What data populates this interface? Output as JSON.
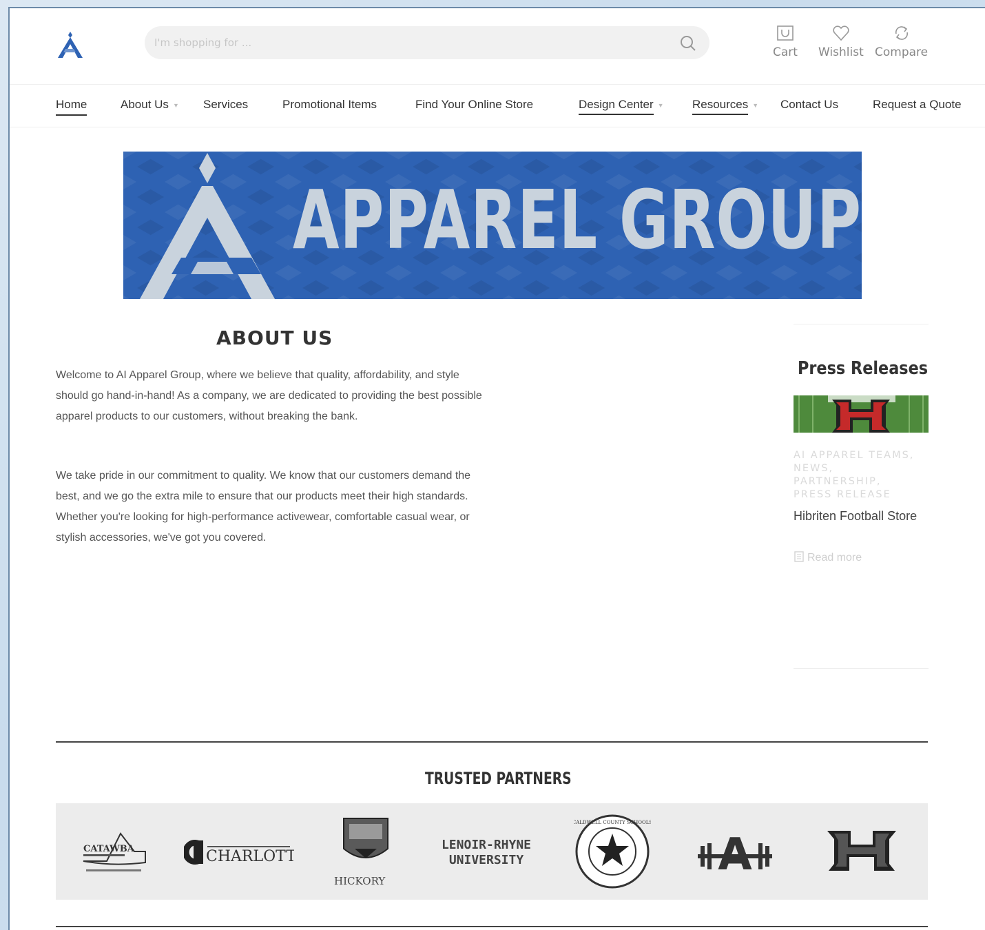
{
  "header": {
    "search_placeholder": "I'm shopping for ...",
    "actions": {
      "cart": "Cart",
      "wishlist": "Wishlist",
      "compare": "Compare"
    }
  },
  "nav": {
    "items": [
      {
        "label": "Home",
        "underlined": true
      },
      {
        "label": "About Us",
        "dropdown": true
      },
      {
        "label": "Services"
      },
      {
        "label": "Promotional Items"
      },
      {
        "label": "Find Your Online Store"
      },
      {
        "label": "Design Center",
        "underlined": true,
        "dropdown": true
      },
      {
        "label": "Resources",
        "underlined": true,
        "dropdown": true
      },
      {
        "label": "Contact Us"
      },
      {
        "label": "Request a Quote"
      }
    ]
  },
  "banner": {
    "title": "APPAREL GROUP",
    "background": "#2e62b3"
  },
  "about": {
    "title": "ABOUT US",
    "paragraphs": [
      "Welcome to AI Apparel Group, where we believe that quality, affordability, and style should go hand-in-hand! As a company, we are dedicated to providing the best possible apparel products to our customers, without breaking the bank.",
      "We take pride in our commitment to quality. We know that our customers demand the best, and we go the extra mile to ensure that our products meet their high standards. Whether you're looking for high-performance activewear, comfortable casual wear, or stylish accessories, we've got you covered."
    ]
  },
  "sidebar": {
    "title": "Press Releases",
    "post": {
      "categories": "AI APPAREL TEAMS, NEWS, PARTNERSHIP, PRESS RELEASE",
      "headline": "Hibriten Football Store",
      "read_more": "Read more"
    }
  },
  "partners": {
    "title": "TRUSTED PARTNERS",
    "logos": [
      {
        "name": "catawba-logo",
        "text": "CATAWBA"
      },
      {
        "name": "charlotte-logo",
        "text": "CHARLOTTE"
      },
      {
        "name": "hickory-logo",
        "text": "HICKORY"
      },
      {
        "name": "lenoir-rhyne-logo",
        "line1": "LENOIR-RHYNE",
        "line2": "UNIVERSITY"
      },
      {
        "name": "caldwell-logo",
        "text": "CALDWELL COUNTY SCHOOLS"
      },
      {
        "name": "ai-athletics-logo",
        "text": "A"
      },
      {
        "name": "hibriten-logo",
        "text": "H"
      }
    ]
  },
  "colors": {
    "brand_blue": "#2e62b3",
    "text_dark": "#333333",
    "muted": "#888888"
  }
}
